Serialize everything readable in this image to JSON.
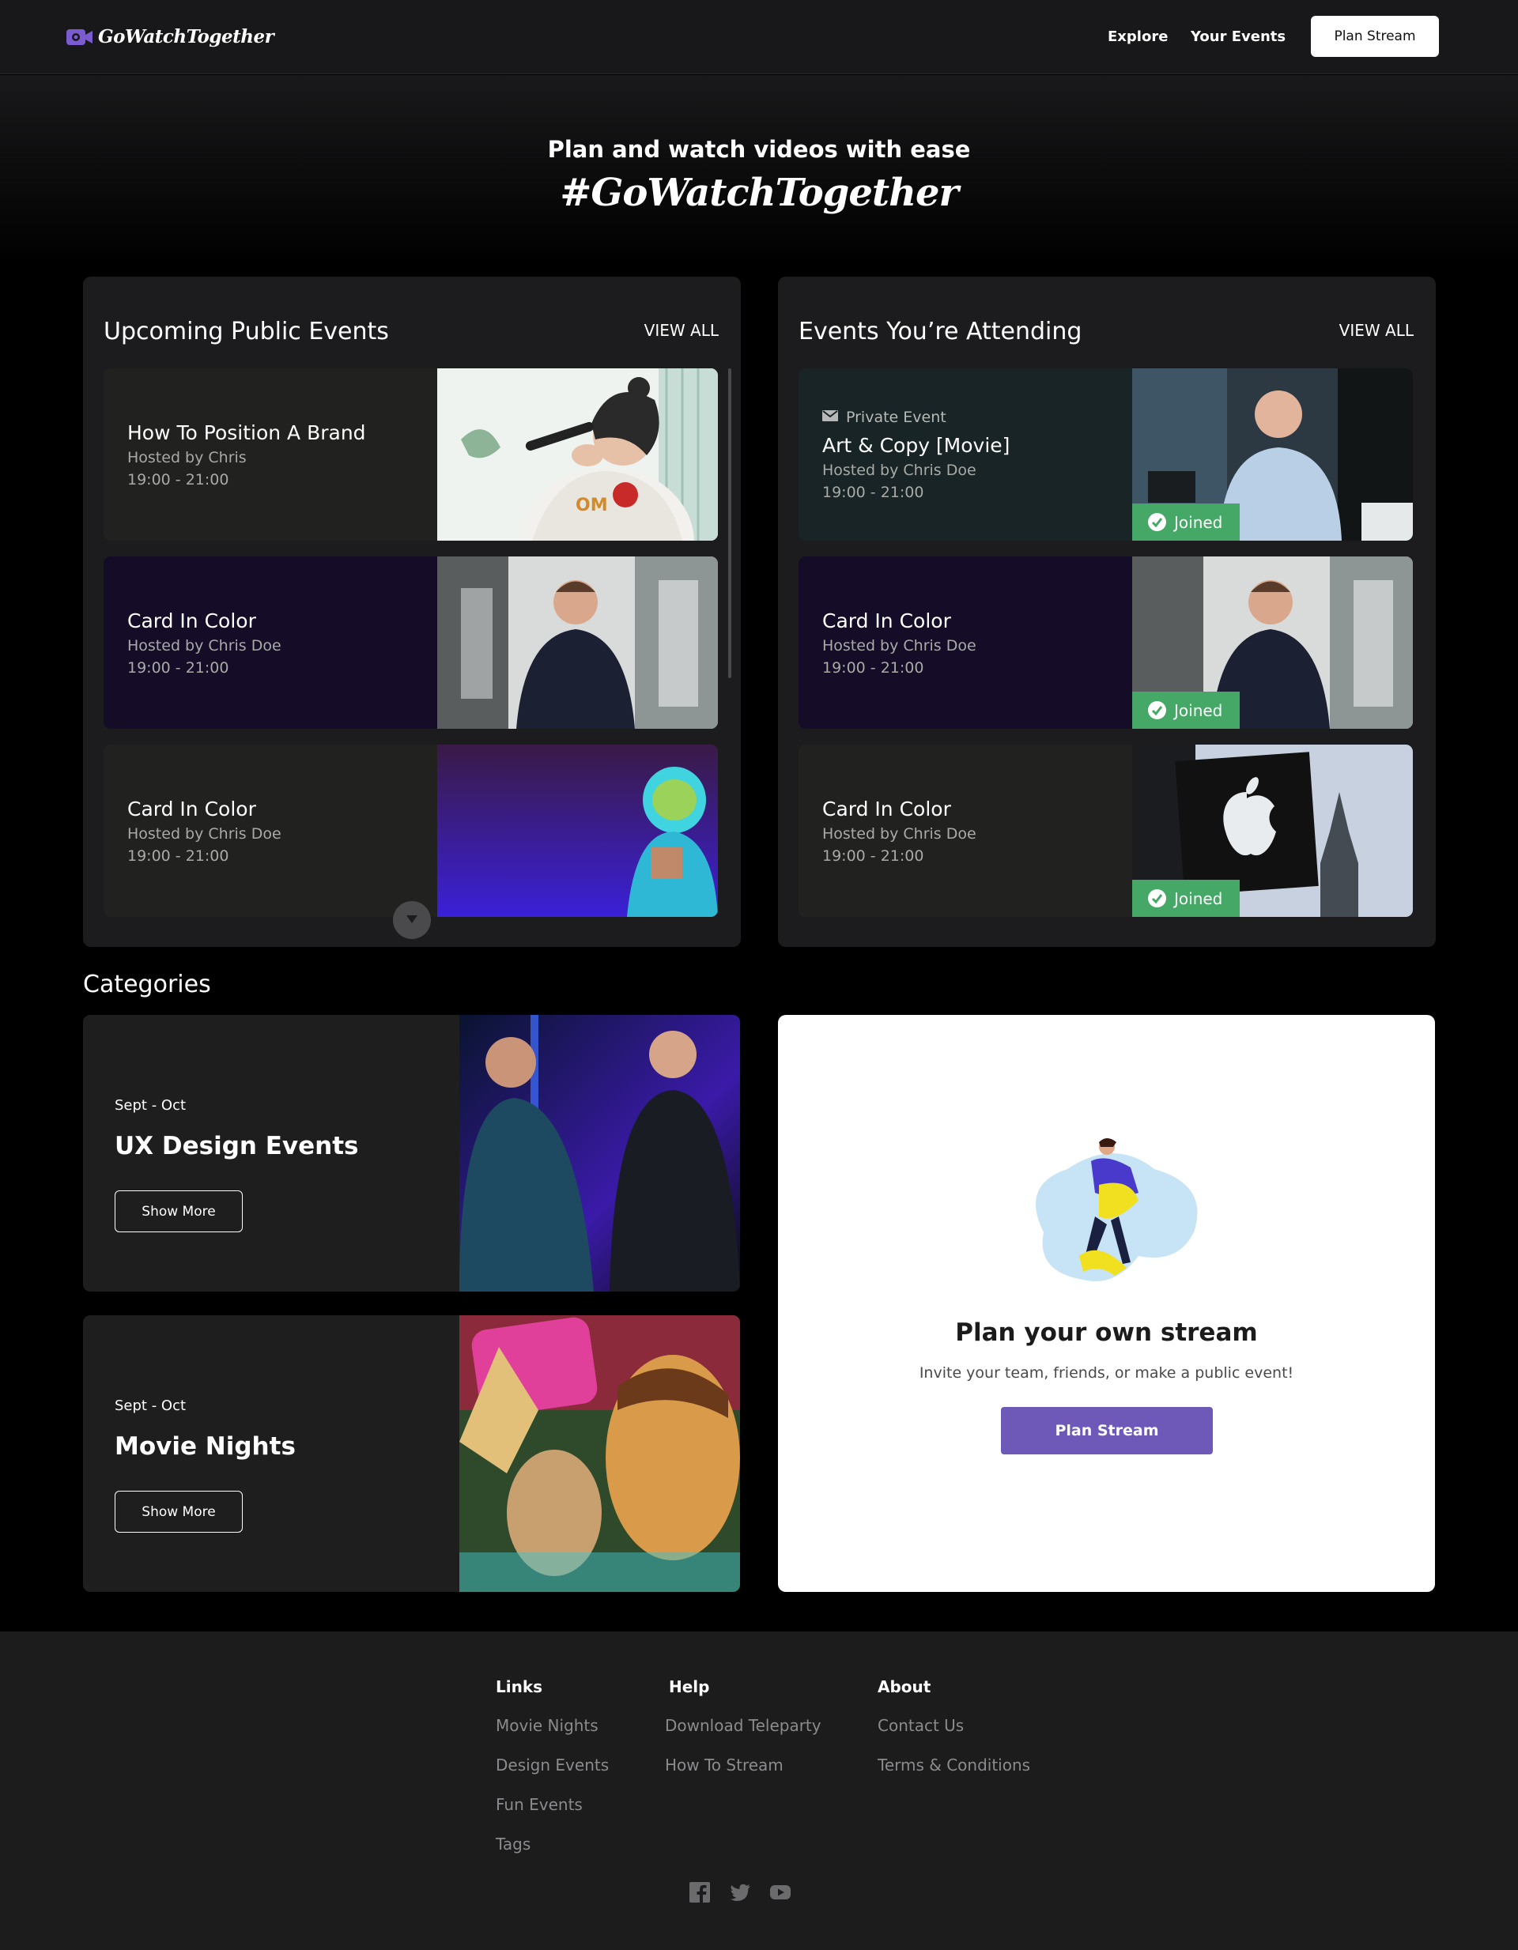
{
  "nav": {
    "brand": "GoWatchTogether",
    "links": [
      "Explore",
      "Your Events"
    ],
    "cta": "Plan Stream"
  },
  "hero": {
    "subtitle": "Plan and watch videos with ease",
    "hashtag": "#GoWatchTogether"
  },
  "upcoming": {
    "title": "Upcoming Public Events",
    "view_all": "VIEW ALL",
    "events": [
      {
        "title": "How To Position A Brand",
        "host": "Hosted by Chris",
        "time": "19:00 - 21:00"
      },
      {
        "title": "Card In Color",
        "host": "Hosted by Chris Doe",
        "time": "19:00 - 21:00"
      },
      {
        "title": "Card In Color",
        "host": "Hosted by Chris Doe",
        "time": "19:00 - 21:00"
      }
    ]
  },
  "attending": {
    "title": "Events You’re Attending",
    "view_all": "VIEW ALL",
    "private_label": "Private Event",
    "joined_label": "Joined",
    "events": [
      {
        "title": "Art & Copy [Movie]",
        "host": "Hosted by Chris Doe",
        "time": "19:00 - 21:00"
      },
      {
        "title": "Card In Color",
        "host": "Hosted by Chris Doe",
        "time": "19:00 - 21:00"
      },
      {
        "title": "Card In Color",
        "host": "Hosted by Chris Doe",
        "time": "19:00 - 21:00"
      }
    ]
  },
  "categories": {
    "title": "Categories",
    "items": [
      {
        "date": "Sept - Oct",
        "name": "UX Design Events",
        "button": "Show More"
      },
      {
        "date": "Sept - Oct",
        "name": "Movie Nights",
        "button": "Show More"
      }
    ]
  },
  "plan": {
    "title": "Plan your own stream",
    "description": "Invite your team, friends, or make a public event!",
    "button": "Plan Stream"
  },
  "footer": {
    "columns": [
      {
        "heading": "Links",
        "links": [
          "Movie Nights",
          "Design Events",
          "Fun Events",
          "Tags"
        ]
      },
      {
        "heading": "Help",
        "links": [
          "Download Teleparty",
          "How To Stream"
        ]
      },
      {
        "heading": "About",
        "links": [
          "Contact Us",
          "Terms & Conditions"
        ]
      }
    ],
    "social": [
      "facebook-icon",
      "twitter-icon",
      "youtube-icon"
    ]
  },
  "colors": {
    "brand_purple": "#7b5bd0",
    "joined_green": "#45a866",
    "cta_purple": "#6e58b8"
  }
}
